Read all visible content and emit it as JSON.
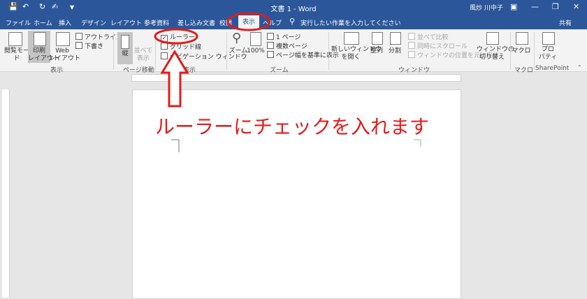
{
  "window": {
    "title": "文書 1 - Word",
    "user": "風炒 川中子"
  },
  "tabs": [
    {
      "label": "ファイル"
    },
    {
      "label": "ホーム"
    },
    {
      "label": "挿入"
    },
    {
      "label": "デザイン"
    },
    {
      "label": "レイアウト"
    },
    {
      "label": "参考資料"
    },
    {
      "label": "差し込み文書"
    },
    {
      "label": "校閲"
    },
    {
      "label": "表示"
    },
    {
      "label": "ヘルプ"
    }
  ],
  "tell_me": "実行したい作業を入力してください",
  "share": "共有",
  "ribbon": {
    "views": {
      "read_mode": "閲覧モード",
      "print_layout": "印刷\nレイアウト",
      "web_layout": "Web\nレイアウト",
      "outline": "アウトライン",
      "draft": "下書き",
      "group": "表示"
    },
    "page_move": {
      "vertical": "縦",
      "side_by_side": "並べて\n表示",
      "group": "ページ移動"
    },
    "show": {
      "ruler": "ルーラー",
      "gridlines": "グリッド線",
      "nav_pane": "ナビゲーション ウィンドウ",
      "group": "表示"
    },
    "zoom": {
      "zoom": "ズーム",
      "percent": "100%",
      "one_page": "1 ページ",
      "multi_page": "複数ページ",
      "page_width": "ページ幅を基準に表示",
      "group": "ズーム"
    },
    "window": {
      "new_window": "新しいウィンドウ\nを開く",
      "arrange": "整列",
      "split": "分割",
      "side": "並べて比較",
      "sync": "同時にスクロール",
      "reset": "ウィンドウの位置を元に戻す",
      "switch": "ウィンドウの\n切り替え",
      "group": "ウィンドウ"
    },
    "macros": {
      "label": "マクロ",
      "group": "マクロ"
    },
    "sharepoint": {
      "label": "プロ\nパティ",
      "group": "SharePoint"
    }
  },
  "annotation": "ルーラーにチェックを入れます",
  "accent": "#2b579a",
  "annot_color": "#e31b1b"
}
